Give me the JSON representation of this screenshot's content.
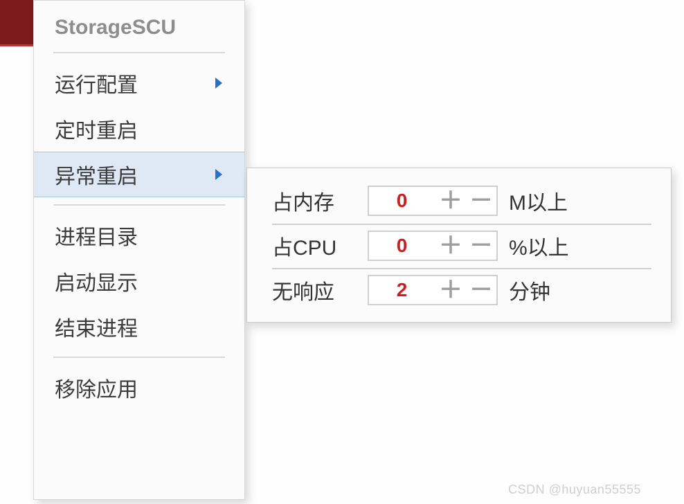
{
  "menu": {
    "title": "StorageSCU",
    "items": [
      {
        "label": "运行配置",
        "hasArrow": true,
        "hover": false
      },
      {
        "label": "定时重启",
        "hasArrow": false,
        "hover": false
      },
      {
        "label": "异常重启",
        "hasArrow": true,
        "hover": true
      },
      {
        "label": "进程目录",
        "hasArrow": false,
        "hover": false
      },
      {
        "label": "启动显示",
        "hasArrow": false,
        "hover": false
      },
      {
        "label": "结束进程",
        "hasArrow": false,
        "hover": false
      },
      {
        "label": "移除应用",
        "hasArrow": false,
        "hover": false
      }
    ]
  },
  "submenu": {
    "rows": [
      {
        "label": "占内存",
        "value": "0",
        "suffix": "M以上"
      },
      {
        "label": "占CPU",
        "value": "0",
        "suffix": "%以上"
      },
      {
        "label": "无响应",
        "value": "2",
        "suffix": "分钟"
      }
    ],
    "plus": "＋",
    "minus": "－"
  },
  "watermark": "CSDN @huyuan55555"
}
